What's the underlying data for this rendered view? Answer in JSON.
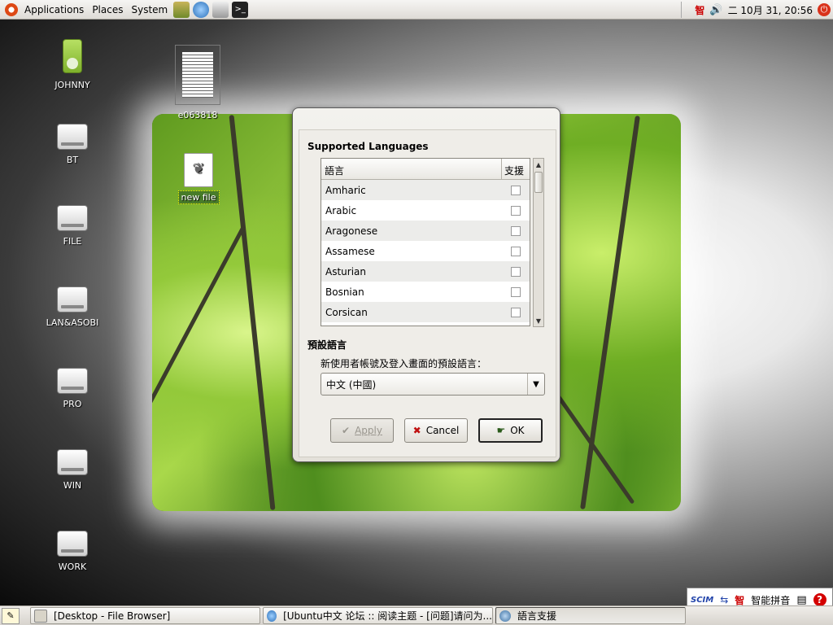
{
  "top_panel": {
    "menus": [
      "Applications",
      "Places",
      "System"
    ],
    "clock": "二 10月 31, 20:56",
    "ime_indicator": "智"
  },
  "desktop": {
    "icons": [
      {
        "label": "JOHNNY",
        "kind": "media-player-icon"
      },
      {
        "label": "BT",
        "kind": "drive-icon"
      },
      {
        "label": "FILE",
        "kind": "drive-icon"
      },
      {
        "label": "LAN&ASOBI",
        "kind": "drive-icon"
      },
      {
        "label": "PRO",
        "kind": "drive-icon"
      },
      {
        "label": "WIN",
        "kind": "drive-icon"
      },
      {
        "label": "WORK",
        "kind": "drive-icon"
      }
    ],
    "document_label": "e063818",
    "newfile_label": "new file"
  },
  "dialog": {
    "supported_title": "Supported Languages",
    "col_language": "語言",
    "col_support": "支援",
    "languages": [
      "Amharic",
      "Arabic",
      "Aragonese",
      "Assamese",
      "Asturian",
      "Bosnian",
      "Corsican"
    ],
    "default_title": "預設語言",
    "default_desc": "新使用者帳號及登入畫面的預設語言：",
    "default_value": "中文 (中國)",
    "apply_label": "Apply",
    "cancel_label": "Cancel",
    "ok_label": "OK"
  },
  "taskbar": {
    "tasks": [
      "[Desktop - File Browser]",
      "[Ubuntu中文 论坛 :: 阅读主题 - [问题]请问为...",
      "語言支援"
    ]
  },
  "ime_bar": {
    "logo": "SCIM",
    "mode": "智",
    "name": "智能拼音",
    "help": "?"
  },
  "colors": {
    "panel": "#dedbd6",
    "ubuntu_orange": "#dd4814",
    "power_red": "#d9321b"
  }
}
